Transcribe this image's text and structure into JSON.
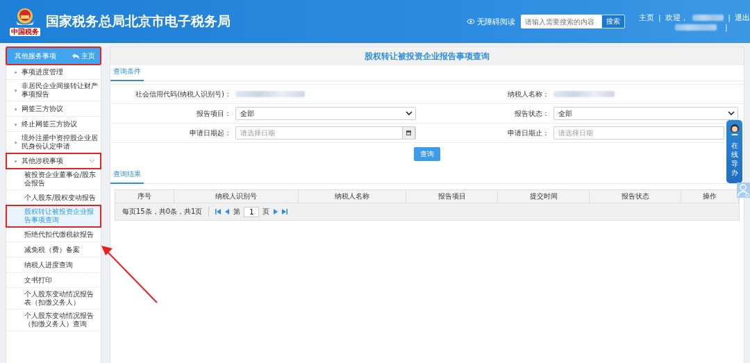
{
  "header": {
    "logo_caption": "中国税务",
    "title": "国家税务总局北京市电子税务局",
    "accessibility": "无障碍阅读",
    "search": {
      "placeholder": "请输入需要搜索的内容",
      "button": "搜索"
    },
    "links": [
      {
        "kind": "link",
        "text": "主页"
      },
      {
        "kind": "sep",
        "text": "|"
      },
      {
        "kind": "text",
        "text": "欢迎，"
      },
      {
        "kind": "redacted"
      },
      {
        "kind": "sep",
        "text": "|"
      },
      {
        "kind": "link",
        "text": "退出"
      }
    ],
    "links_row2": [
      {
        "kind": "redacted"
      },
      {
        "kind": "sep",
        "text": "|"
      }
    ]
  },
  "sidebar": {
    "title": "其他服务事项",
    "home": "主页",
    "highlighted": true,
    "items": [
      {
        "label": "事项进度管理",
        "selected": false,
        "highlighted": false
      },
      {
        "label": "非居民企业间接转让财产事项报告",
        "selected": false,
        "highlighted": false
      },
      {
        "label": "网签三方协议",
        "selected": false,
        "highlighted": false
      },
      {
        "label": "终止网签三方协议",
        "selected": false,
        "highlighted": false
      },
      {
        "label": "境外注册中资控股企业居民身份认定申请",
        "selected": false,
        "highlighted": false
      },
      {
        "label": "其他涉税事项",
        "selected": false,
        "highlighted": true,
        "expanded": true,
        "children": [
          {
            "label": "被投资企业董事会/股东会报告",
            "selected": false,
            "highlighted": false
          },
          {
            "label": "个人股东/股权变动报告",
            "selected": false,
            "highlighted": false
          },
          {
            "label": "股权转让被投资企业报告事项查询",
            "selected": true,
            "highlighted": true
          },
          {
            "label": "拒绝代扣代缴税款报告",
            "selected": false,
            "highlighted": false
          },
          {
            "label": "减免税（费）备案",
            "selected": false,
            "highlighted": false
          },
          {
            "label": "纳税人进度查询",
            "selected": false,
            "highlighted": false
          },
          {
            "label": "文书打印",
            "selected": false,
            "highlighted": false
          },
          {
            "label": "个人股东变动情况报告表（扣缴义务人）",
            "selected": false,
            "highlighted": false
          },
          {
            "label": "个人股东变动情况报告（扣缴义务人）查询",
            "selected": false,
            "highlighted": false
          }
        ]
      }
    ]
  },
  "page_title": "股权转让被投资企业报告事项查询",
  "conditions_tab": "查询条件",
  "form": [
    {
      "label": "社会信用代码(纳税人识别号)：",
      "kind": "redacted"
    },
    {
      "label": "纳税人名称：",
      "kind": "redacted"
    },
    {
      "label": "报告项目：",
      "kind": "select",
      "value": "全部"
    },
    {
      "label": "报告状态：",
      "kind": "select",
      "value": "全部"
    },
    {
      "label": "申请日期起：",
      "kind": "date",
      "placeholder": "请选择日期"
    },
    {
      "label": "申请日期止：",
      "kind": "date_plain",
      "placeholder": "请选择日期"
    }
  ],
  "query_button": "查询",
  "results_tab": "查询结果",
  "table": {
    "columns": [
      "序号",
      "纳税人识别号",
      "纳税人名称",
      "报告项目",
      "提交时间",
      "报告状态",
      "操作"
    ]
  },
  "pager": {
    "summary": "每页15条，共0条，共1页",
    "page_prefix": "第",
    "page": "1",
    "page_suffix": "页"
  },
  "guide": {
    "label": "在线导办"
  }
}
